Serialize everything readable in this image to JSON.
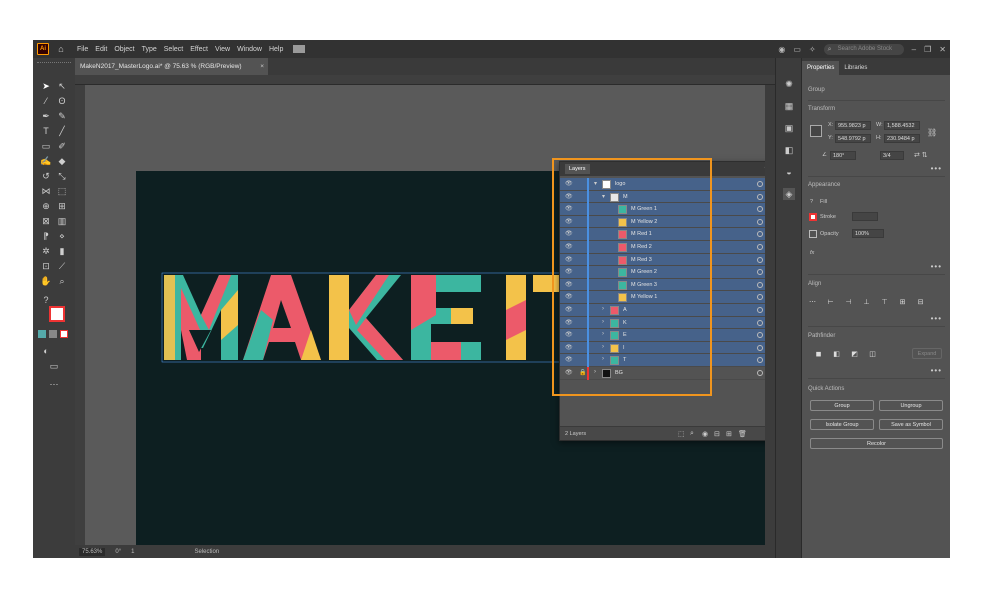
{
  "menubar": {
    "app_logo": "Ai",
    "items": [
      "File",
      "Edit",
      "Object",
      "Type",
      "Select",
      "Effect",
      "View",
      "Window",
      "Help"
    ],
    "search_placeholder": "Search Adobe Stock"
  },
  "document_tab": {
    "title": "MakeN2017_MasterLogo.ai* @ 75.63 % (RGB/Preview)",
    "close": "×"
  },
  "status_bar": {
    "zoom": "75.63%",
    "rotation": "0°",
    "artboard_nav": "1",
    "mode": "Selection"
  },
  "properties_panel": {
    "tabs": [
      "Properties",
      "Libraries"
    ],
    "selection_type": "Group",
    "transform": {
      "title": "Transform",
      "x": "955.9823 p",
      "y": "548.9792 p",
      "w": "1,588.4532",
      "h": "230.9484 p",
      "angle": "180°",
      "h_label": "H:",
      "angle_ratio": "3/4"
    },
    "appearance": {
      "title": "Appearance",
      "fill_label": "Fill",
      "stroke_label": "Stroke",
      "opacity_label": "Opacity",
      "opacity_value": "100%",
      "fx": "fx"
    },
    "align_title": "Align",
    "pathfinder_title": "Pathfinder",
    "expand_label": "Expand",
    "quick_actions": {
      "title": "Quick Actions",
      "group": "Group",
      "ungroup": "Ungroup",
      "isolate_group": "Isolate Group",
      "save_as_symbol": "Save as Symbol",
      "recolor": "Recolor"
    }
  },
  "layers_panel": {
    "title": "Layers",
    "count_label": "2 Layers",
    "rows": [
      {
        "name": "logo",
        "indent": 0,
        "twirl": "▾",
        "selected": true
      },
      {
        "name": "M",
        "indent": 1,
        "twirl": "▾",
        "selected": true
      },
      {
        "name": "M Green 1",
        "indent": 2,
        "twirl": "",
        "selected": true
      },
      {
        "name": "M Yellow 2",
        "indent": 2,
        "twirl": "",
        "selected": true
      },
      {
        "name": "M Red 1",
        "indent": 2,
        "twirl": "",
        "selected": true
      },
      {
        "name": "M Red 2",
        "indent": 2,
        "twirl": "",
        "selected": true
      },
      {
        "name": "M Red 3",
        "indent": 2,
        "twirl": "",
        "selected": true
      },
      {
        "name": "M Green 2",
        "indent": 2,
        "twirl": "",
        "selected": true
      },
      {
        "name": "M Green 3",
        "indent": 2,
        "twirl": "",
        "selected": true
      },
      {
        "name": "M Yellow 1",
        "indent": 2,
        "twirl": "",
        "selected": true
      },
      {
        "name": "A",
        "indent": 1,
        "twirl": "›",
        "selected": true
      },
      {
        "name": "K",
        "indent": 1,
        "twirl": "›",
        "selected": true
      },
      {
        "name": "E",
        "indent": 1,
        "twirl": "›",
        "selected": true
      },
      {
        "name": "I",
        "indent": 1,
        "twirl": "›",
        "selected": true
      },
      {
        "name": "T",
        "indent": 1,
        "twirl": "›",
        "selected": true
      },
      {
        "name": "BG",
        "indent": 0,
        "twirl": "›",
        "selected": false
      }
    ]
  },
  "colors": {
    "accent": "#f0951e",
    "selection_blue": "#4a90e2",
    "artboard": "#0d1f21",
    "teal": "#3cb6a0",
    "coral": "#ec5a6a",
    "yellow": "#f3c24a"
  }
}
